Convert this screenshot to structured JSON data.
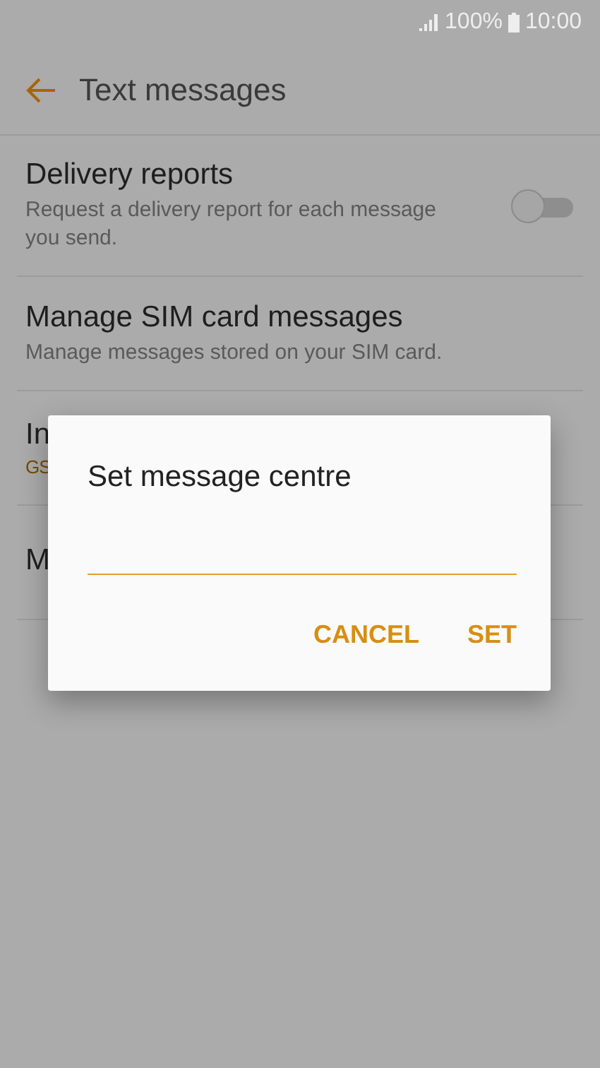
{
  "status_bar": {
    "battery": "100%",
    "time": "10:00"
  },
  "header": {
    "title": "Text messages"
  },
  "settings": [
    {
      "kind": "toggle",
      "title": "Delivery reports",
      "subtitle": "Request a delivery report for each message you send.",
      "on": false
    },
    {
      "kind": "plain",
      "title": "Manage SIM card messages",
      "subtitle": "Manage messages stored on your SIM card."
    },
    {
      "kind": "value",
      "title": "In",
      "value": "GS"
    },
    {
      "kind": "plain",
      "title": "M"
    }
  ],
  "dialog": {
    "title": "Set message centre",
    "buttons": [
      "CANCEL",
      "SET"
    ]
  }
}
